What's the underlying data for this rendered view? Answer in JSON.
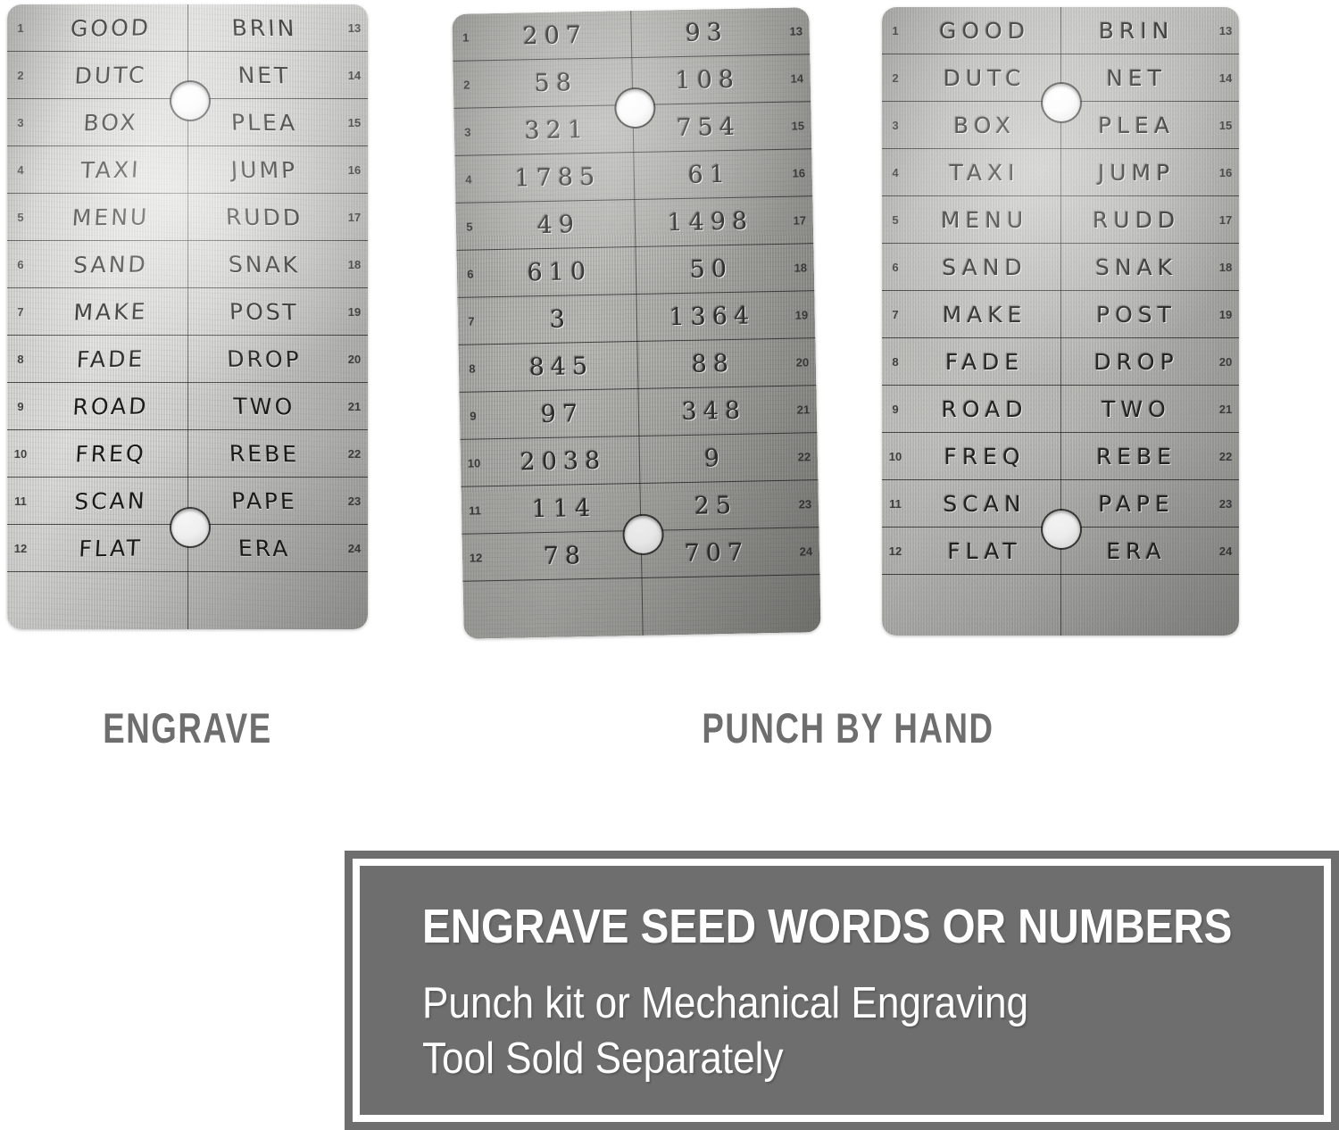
{
  "plates": [
    {
      "id": "engrave",
      "caption": "ENGRAVE",
      "style": "engraved-handwriting",
      "left_indices": [
        "1",
        "2",
        "3",
        "4",
        "5",
        "6",
        "7",
        "8",
        "9",
        "10",
        "11",
        "12"
      ],
      "right_indices": [
        "13",
        "14",
        "15",
        "16",
        "17",
        "18",
        "19",
        "20",
        "21",
        "22",
        "23",
        "24"
      ],
      "left_values": [
        "GOOD",
        "DUTC",
        "BOX",
        "TAXI",
        "MENU",
        "SAND",
        "MAKE",
        "FADE",
        "ROAD",
        "FREQ",
        "SCAN",
        "FLAT"
      ],
      "right_values": [
        "BRIN",
        "NET",
        "PLEA",
        "JUMP",
        "RUDD",
        "SNAK",
        "POST",
        "DROP",
        "TWO",
        "REBE",
        "PAPE",
        "ERA"
      ]
    },
    {
      "id": "punch",
      "caption": "PUNCH BY HAND",
      "style": "hand-punched-digits",
      "left_indices": [
        "1",
        "2",
        "3",
        "4",
        "5",
        "6",
        "7",
        "8",
        "9",
        "10",
        "11",
        "12"
      ],
      "right_indices": [
        "13",
        "14",
        "15",
        "16",
        "17",
        "18",
        "19",
        "20",
        "21",
        "22",
        "23",
        "24"
      ],
      "left_values": [
        "207",
        "58",
        "321",
        "1785",
        "49",
        "610",
        "3",
        "845",
        "97",
        "2038",
        "114",
        "78"
      ],
      "right_values": [
        "93",
        "108",
        "754",
        "61",
        "1498",
        "50",
        "1364",
        "88",
        "348",
        "9",
        "25",
        "707"
      ]
    },
    {
      "id": "stamp",
      "caption": "",
      "style": "stamped-letters",
      "left_indices": [
        "1",
        "2",
        "3",
        "4",
        "5",
        "6",
        "7",
        "8",
        "9",
        "10",
        "11",
        "12"
      ],
      "right_indices": [
        "13",
        "14",
        "15",
        "16",
        "17",
        "18",
        "19",
        "20",
        "21",
        "22",
        "23",
        "24"
      ],
      "left_values": [
        "GOOD",
        "DUTC",
        "BOX",
        "TAXI",
        "MENU",
        "SAND",
        "MAKE",
        "FADE",
        "ROAD",
        "FREQ",
        "SCAN",
        "FLAT"
      ],
      "right_values": [
        "BRIN",
        "NET",
        "PLEA",
        "JUMP",
        "RUDD",
        "SNAK",
        "POST",
        "DROP",
        "TWO",
        "REBE",
        "PAPE",
        "ERA"
      ]
    }
  ],
  "captions": {
    "engrave": "ENGRAVE",
    "punch": "PUNCH BY HAND"
  },
  "banner": {
    "heading": "ENGRAVE SEED WORDS OR NUMBERS",
    "line2": "Punch kit or Mechanical Engraving",
    "line3": "Tool Sold Separately"
  },
  "colors": {
    "banner_gray": "#6e6e6e",
    "caption_gray": "#6e6e6e",
    "banner_text": "#ffffff",
    "page_background": "#ffffff",
    "engraving_ink": "#1b1b1b"
  }
}
